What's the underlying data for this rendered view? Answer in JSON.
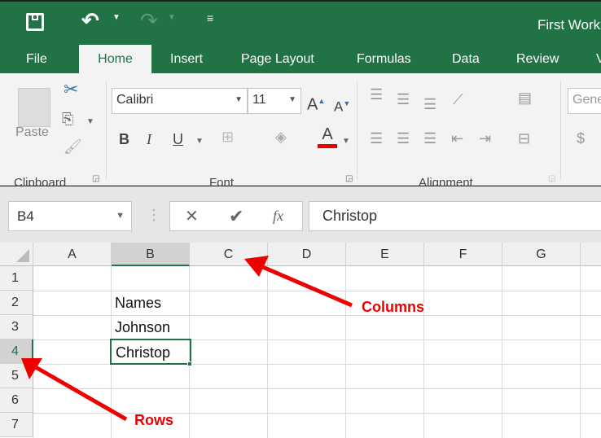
{
  "title": "First Work",
  "qat": {
    "save": "save-icon",
    "undo": "undo-icon",
    "redo": "redo-icon",
    "customize": "customize-icon"
  },
  "tabs": [
    "File",
    "Home",
    "Insert",
    "Page Layout",
    "Formulas",
    "Data",
    "Review",
    "V"
  ],
  "ribbon": {
    "paste": "Paste",
    "font_name": "Calibri",
    "font_size": "11",
    "bold": "B",
    "italic": "I",
    "underline": "U",
    "font_color": "A",
    "number_format": "Gene",
    "currency": "$",
    "groups": {
      "clipboard": "Clipboard",
      "font": "Font",
      "alignment": "Alignment"
    }
  },
  "formula_bar": {
    "name_box": "B4",
    "fx": "fx",
    "value": "Christop"
  },
  "columns": [
    "A",
    "B",
    "C",
    "D",
    "E",
    "F",
    "G"
  ],
  "rows": [
    "1",
    "2",
    "3",
    "4",
    "5",
    "6",
    "7"
  ],
  "cells": {
    "B2": "Names",
    "B3": "Johnson",
    "B4": "Christop"
  },
  "selected_cell": "B4",
  "annotations": {
    "columns": "Columns",
    "rows": "Rows"
  },
  "colors": {
    "brand": "#217346",
    "annotation": "#e00000"
  }
}
